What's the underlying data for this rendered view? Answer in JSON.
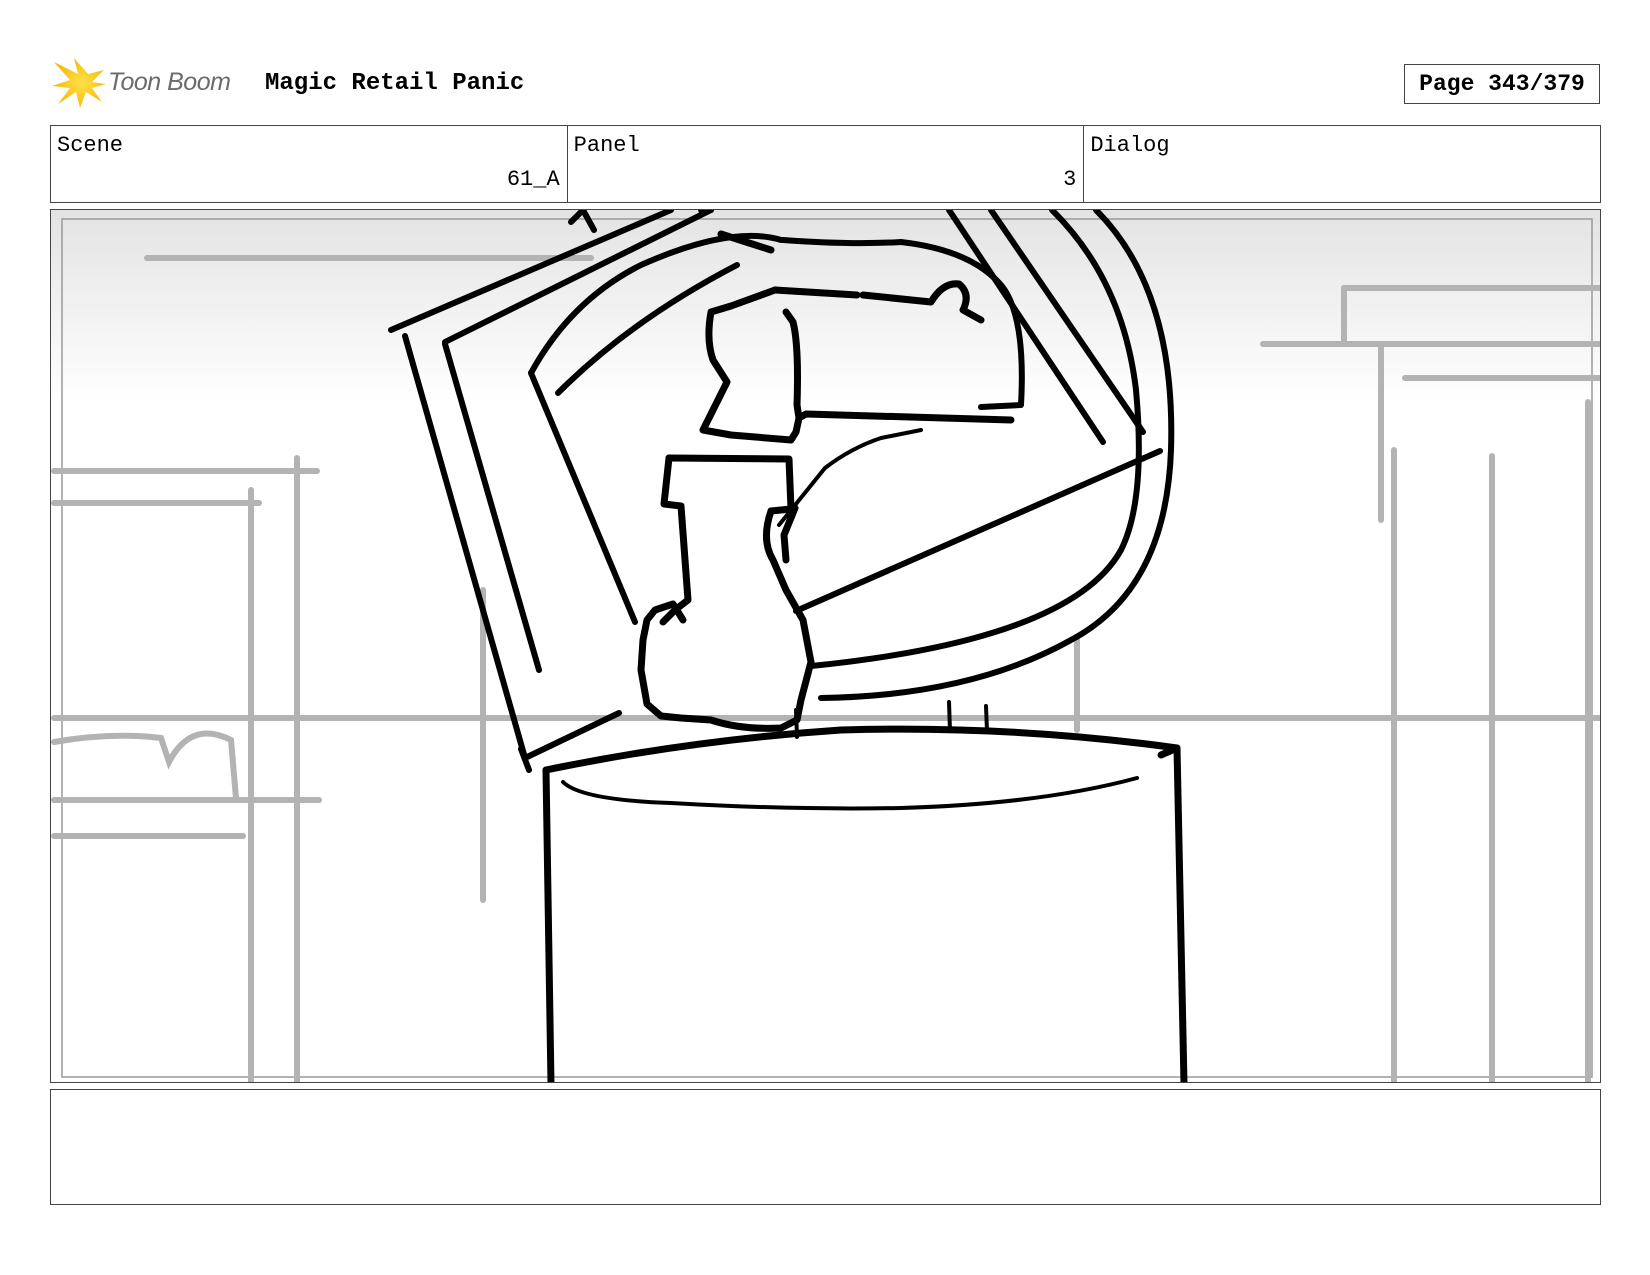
{
  "header": {
    "logo_text": "Toon Boom",
    "project_title": "Magic Retail Panic",
    "page_label": "Page 343/379"
  },
  "info": {
    "scene_label": "Scene",
    "scene_value": "61_A",
    "panel_label": "Panel",
    "panel_value": "3",
    "dialog_label": "Dialog",
    "dialog_value": ""
  },
  "notes": {
    "text": ""
  },
  "colors": {
    "logo_yellow": "#f5c400",
    "sketch_gray": "#b3b3b3",
    "ink": "#000000"
  },
  "icons": {
    "logo": "toon-boom-starburst-icon"
  }
}
